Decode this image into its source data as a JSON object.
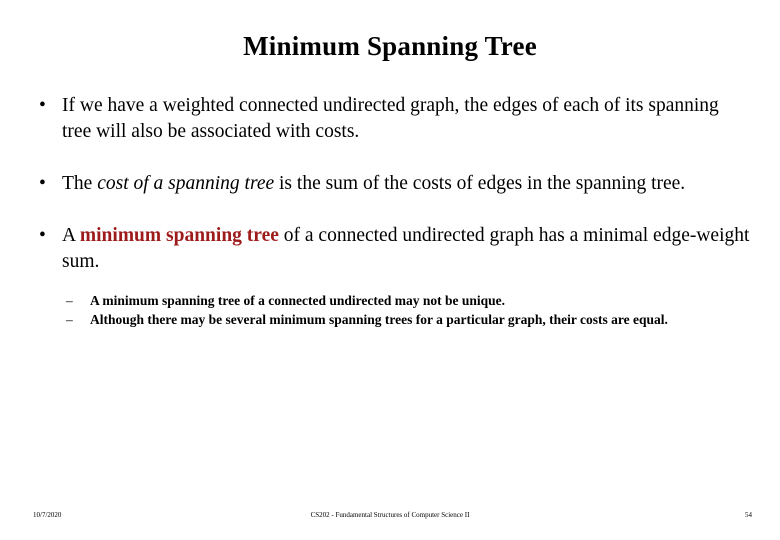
{
  "slide": {
    "title": "Minimum Spanning Tree",
    "bullet_marker": "•",
    "sub_bullet_marker": "–",
    "accent_color": "#9E1B1B",
    "bullets": [
      {
        "marker": "•",
        "part1": "If we have  a weighted connected undirected graph, the edges of each of its spanning tree will also be associated with costs."
      },
      {
        "marker": "•",
        "lead": "The ",
        "italic": "cost of a spanning tree",
        "tail": " is the sum of the costs of edges in the spanning tree."
      },
      {
        "marker": "•",
        "lead": "A ",
        "emphasis": "minimum spanning tree",
        "tail": " of a connected undirected graph has a minimal edge-weight sum."
      }
    ],
    "sub_bullets": [
      {
        "marker": "–",
        "text": "A minimum spanning tree of a connected undirected may not be unique."
      },
      {
        "marker": "–",
        "text": "Although there may be several minimum spanning trees for a particular graph, their costs are equal."
      }
    ]
  },
  "footer": {
    "date": "10/7/2020",
    "course": "CS202 - Fundamental Structures of Computer Science II",
    "page_number": "54"
  }
}
